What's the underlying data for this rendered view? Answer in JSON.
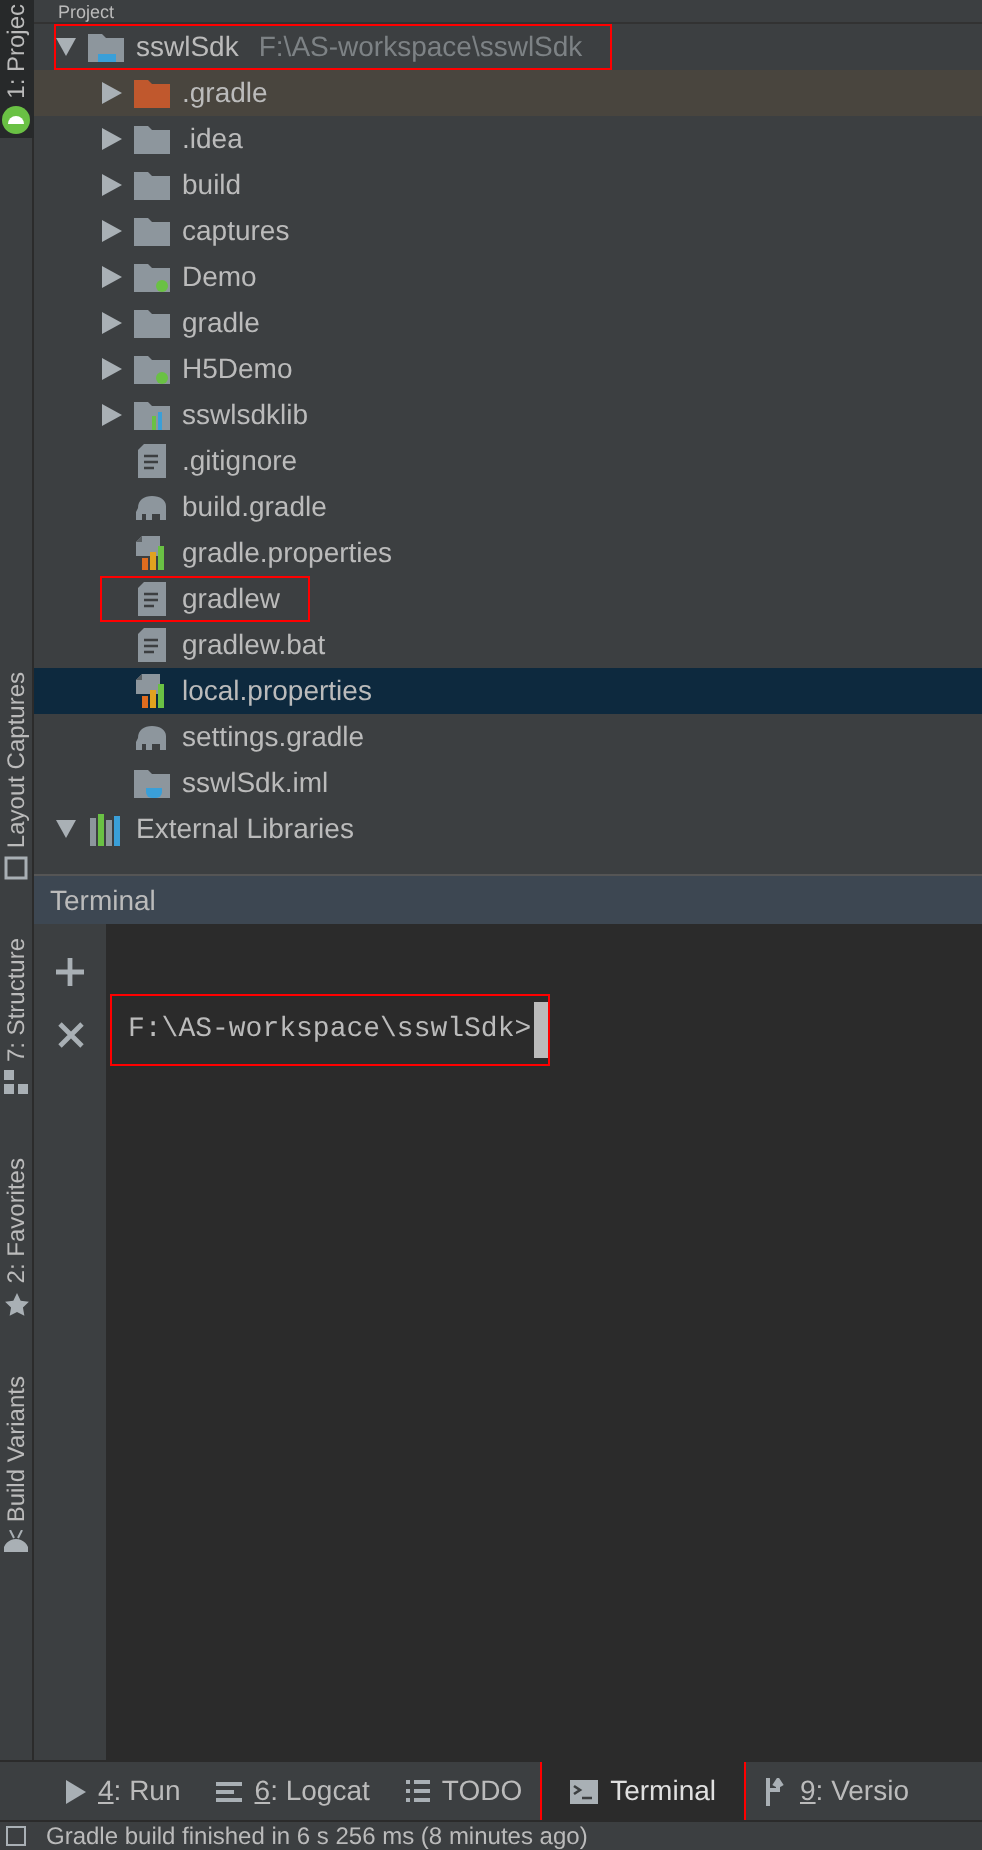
{
  "side_tools": [
    {
      "label": "1: Projec",
      "kind": "project",
      "selected": true
    },
    {
      "label": "Layout Captures",
      "kind": "captures",
      "selected": false
    },
    {
      "label": "7: Structure",
      "kind": "structure",
      "selected": false
    },
    {
      "label": "2: Favorites",
      "kind": "favorites",
      "selected": false
    },
    {
      "label": "Build Variants",
      "kind": "variants",
      "selected": false
    }
  ],
  "project_panel": {
    "title": "Project",
    "tree": [
      {
        "name": "sswlSdk",
        "path": "F:\\AS-workspace\\sswlSdk",
        "kind": "module",
        "expanded": true,
        "selected": false,
        "annotated": true,
        "children": [
          {
            "name": ".gradle",
            "kind": "excluded_folder",
            "expanded": false,
            "selected": false,
            "annotated": false
          },
          {
            "name": ".idea",
            "kind": "folder",
            "expanded": false,
            "selected": false,
            "annotated": false
          },
          {
            "name": "build",
            "kind": "folder",
            "expanded": false,
            "selected": false,
            "annotated": false
          },
          {
            "name": "captures",
            "kind": "folder",
            "expanded": false,
            "selected": false,
            "annotated": false
          },
          {
            "name": "Demo",
            "kind": "app_module",
            "expanded": false,
            "selected": false,
            "annotated": false
          },
          {
            "name": "gradle",
            "kind": "folder",
            "expanded": false,
            "selected": false,
            "annotated": false
          },
          {
            "name": "H5Demo",
            "kind": "app_module",
            "expanded": false,
            "selected": false,
            "annotated": false
          },
          {
            "name": "sswlsdklib",
            "kind": "library_module",
            "expanded": false,
            "selected": false,
            "annotated": false
          },
          {
            "name": ".gitignore",
            "kind": "file",
            "selected": false,
            "annotated": false
          },
          {
            "name": "build.gradle",
            "kind": "gradle",
            "selected": false,
            "annotated": false
          },
          {
            "name": "gradle.properties",
            "kind": "properties",
            "selected": false,
            "annotated": false
          },
          {
            "name": "gradlew",
            "kind": "file",
            "selected": false,
            "annotated": true
          },
          {
            "name": "gradlew.bat",
            "kind": "file",
            "selected": false,
            "annotated": false
          },
          {
            "name": "local.properties",
            "kind": "properties",
            "selected": true,
            "annotated": false
          },
          {
            "name": "settings.gradle",
            "kind": "gradle",
            "selected": false,
            "annotated": false
          },
          {
            "name": "sswlSdk.iml",
            "kind": "iml",
            "selected": false,
            "annotated": false
          }
        ]
      },
      {
        "name": "External Libraries",
        "kind": "libraries",
        "expanded": true,
        "selected": false,
        "annotated": false
      }
    ]
  },
  "terminal": {
    "title": "Terminal",
    "prompt": "F:\\AS-workspace\\sswlSdk>",
    "annotated": true
  },
  "bottom_tabs": [
    {
      "key": "4",
      "label": ": Run",
      "kind": "run",
      "selected": false,
      "annotated": false
    },
    {
      "key": "6",
      "label": ": Logcat",
      "kind": "logcat",
      "selected": false,
      "annotated": false
    },
    {
      "label": "TODO",
      "kind": "todo",
      "selected": false,
      "annotated": false
    },
    {
      "label": "Terminal",
      "kind": "terminal",
      "selected": true,
      "annotated": true
    },
    {
      "key": "9",
      "label": ": Versio",
      "kind": "vcs",
      "selected": false,
      "annotated": false
    }
  ],
  "status_bar": {
    "message": "Gradle build finished in 6 s 256 ms (8 minutes ago)"
  }
}
